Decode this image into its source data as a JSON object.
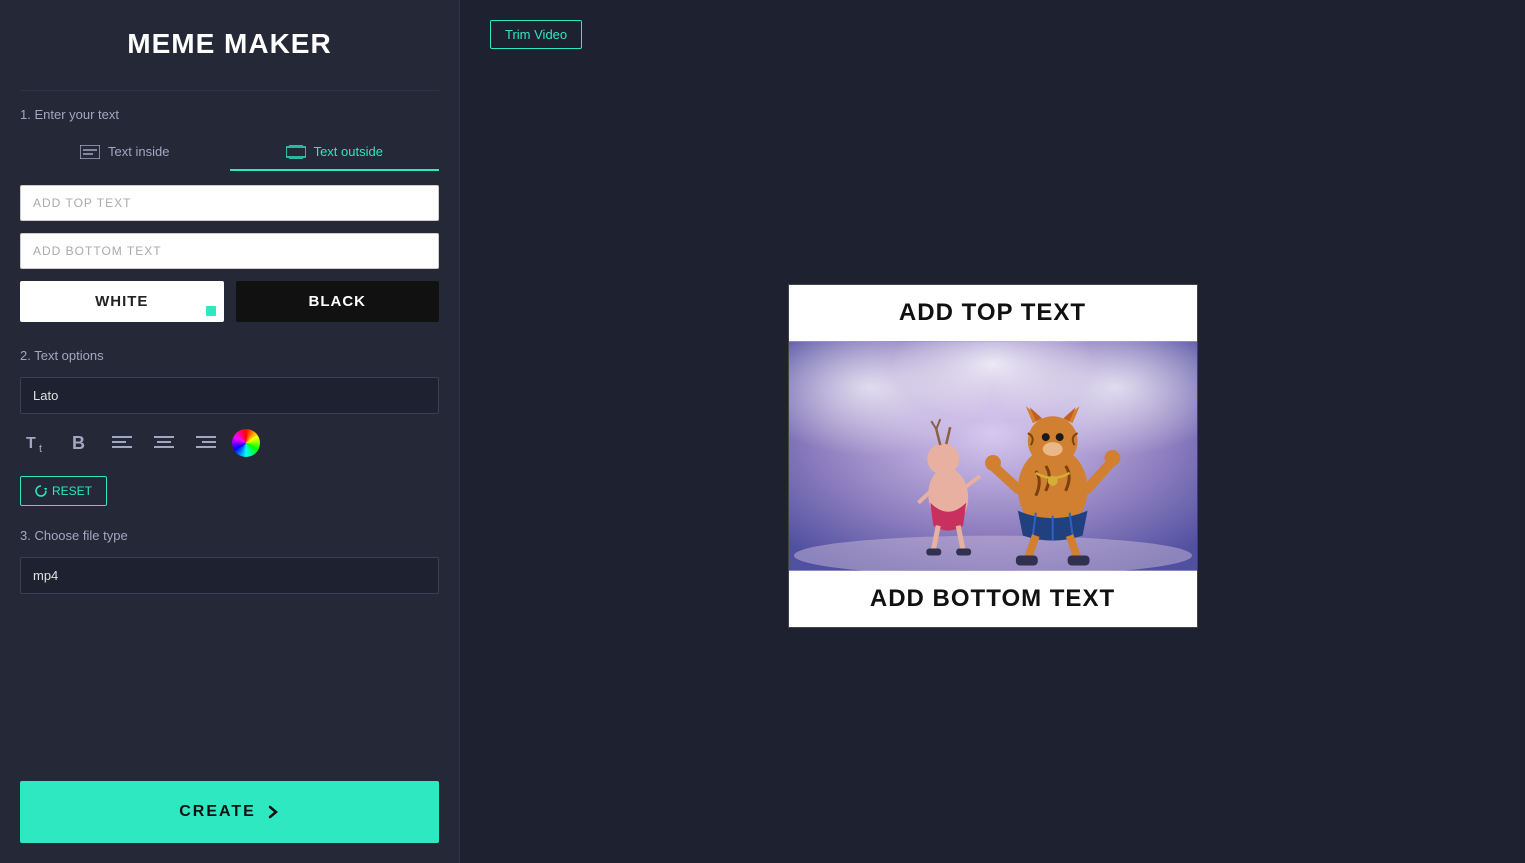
{
  "app": {
    "title": "MEME MAKER"
  },
  "header": {
    "trim_video_label": "Trim Video"
  },
  "section1": {
    "label": "1. Enter your text",
    "tab_inside_label": "Text inside",
    "tab_outside_label": "Text outside",
    "top_text_placeholder": "ADD TOP TEXT",
    "bottom_text_placeholder": "ADD BOTTOM TEXT",
    "white_btn_label": "WHITE",
    "black_btn_label": "BLACK"
  },
  "section2": {
    "label": "2. Text options",
    "font_value": "Lato",
    "reset_label": "RESET"
  },
  "section3": {
    "label": "3. Choose file type",
    "file_type_value": "mp4"
  },
  "create": {
    "label": "CREATE"
  },
  "preview": {
    "top_text": "ADD TOP TEXT",
    "bottom_text": "ADD BOTTOM TEXT"
  },
  "colors": {
    "accent": "#2de8c0",
    "bg_dark": "#1e2130",
    "bg_panel": "#252836"
  }
}
